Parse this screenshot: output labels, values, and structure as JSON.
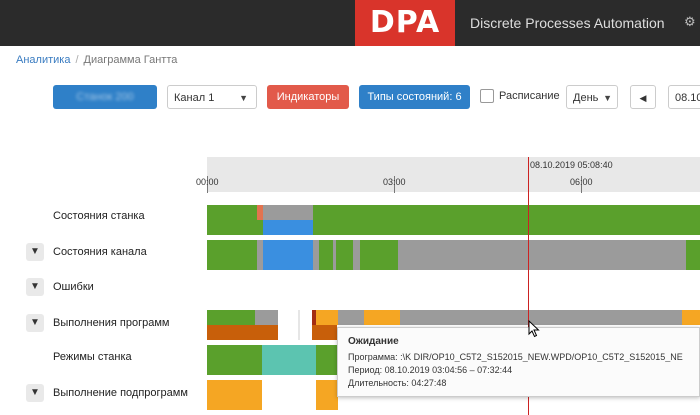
{
  "header": {
    "logo": "DPA",
    "brand": "Discrete Processes Automation",
    "icon": "settings-icon"
  },
  "breadcrumb": {
    "root": "Аналитика",
    "separator": "/",
    "current": "Диаграмма Гантта"
  },
  "toolbar": {
    "machine_button": "Станок 200",
    "channel_select": "Канал 1",
    "indicators_button": "Индикаторы",
    "state_types_button": "Типы состояний: 6",
    "schedule_label": "Расписание",
    "period_select": "День",
    "prev_icon": "triangle-left-icon",
    "date_field": "08.10."
  },
  "timeline": {
    "ticks": [
      "00:00",
      "03:00",
      "06:00"
    ],
    "cursor_label": "08.10.2019 05:08:40"
  },
  "rows": [
    {
      "label": "Состояния станка",
      "expandable": false
    },
    {
      "label": "Состояния канала",
      "expandable": true
    },
    {
      "label": "Ошибки",
      "expandable": true
    },
    {
      "label": "Выполнения программ",
      "expandable": true
    },
    {
      "label": "Режимы станка",
      "expandable": false
    },
    {
      "label": "Выполнение подпрограмм",
      "expandable": true
    }
  ],
  "colors": {
    "green": "#5aa02c",
    "gray": "#9b9b9b",
    "blue": "#3a8fe0",
    "orange": "#f5a623",
    "dark_orange": "#c85f0a",
    "teal": "#5cc4b0",
    "red_cursor": "#cc2222",
    "salmon": "#e2734f"
  },
  "tooltip": {
    "title": "Ожидание",
    "program": "Программа: :\\K    DIR/OP10_C5T2_S152015_NEW.WPD/OP10_C5T2_S152015_NE",
    "period": "Период: 08.10.2019 03:04:56 – 07:32:44",
    "duration": "Длительность: 04:27:48"
  }
}
